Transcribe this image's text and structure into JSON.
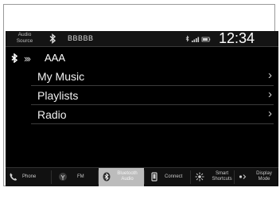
{
  "header": {
    "audio_source_line1": "Audio",
    "audio_source_line2": "Source",
    "device_name": "BBBBB",
    "clock": "12:34"
  },
  "now_playing": {
    "device": "AAA"
  },
  "menu": {
    "items": [
      {
        "label": "My Music"
      },
      {
        "label": "Playlists"
      },
      {
        "label": "Radio"
      }
    ]
  },
  "bottom_bar": {
    "tabs": [
      {
        "label": "Phone"
      },
      {
        "label": "FM"
      },
      {
        "label_line1": "Bluetooth",
        "label_line2": "Audio"
      },
      {
        "label": "Connect"
      },
      {
        "label_line1": "Smart",
        "label_line2": "Shortcuts"
      },
      {
        "label_line1": "Display",
        "label_line2": "Mode"
      }
    ]
  },
  "colors": {
    "screen_bg": "#000000",
    "active_tab": "#bcbcbc",
    "text": "#f0f0f0"
  },
  "icons": [
    "bluetooth-icon",
    "signal-icon",
    "battery-icon",
    "phone-icon",
    "antenna-icon",
    "usb-icon",
    "sun-icon"
  ]
}
